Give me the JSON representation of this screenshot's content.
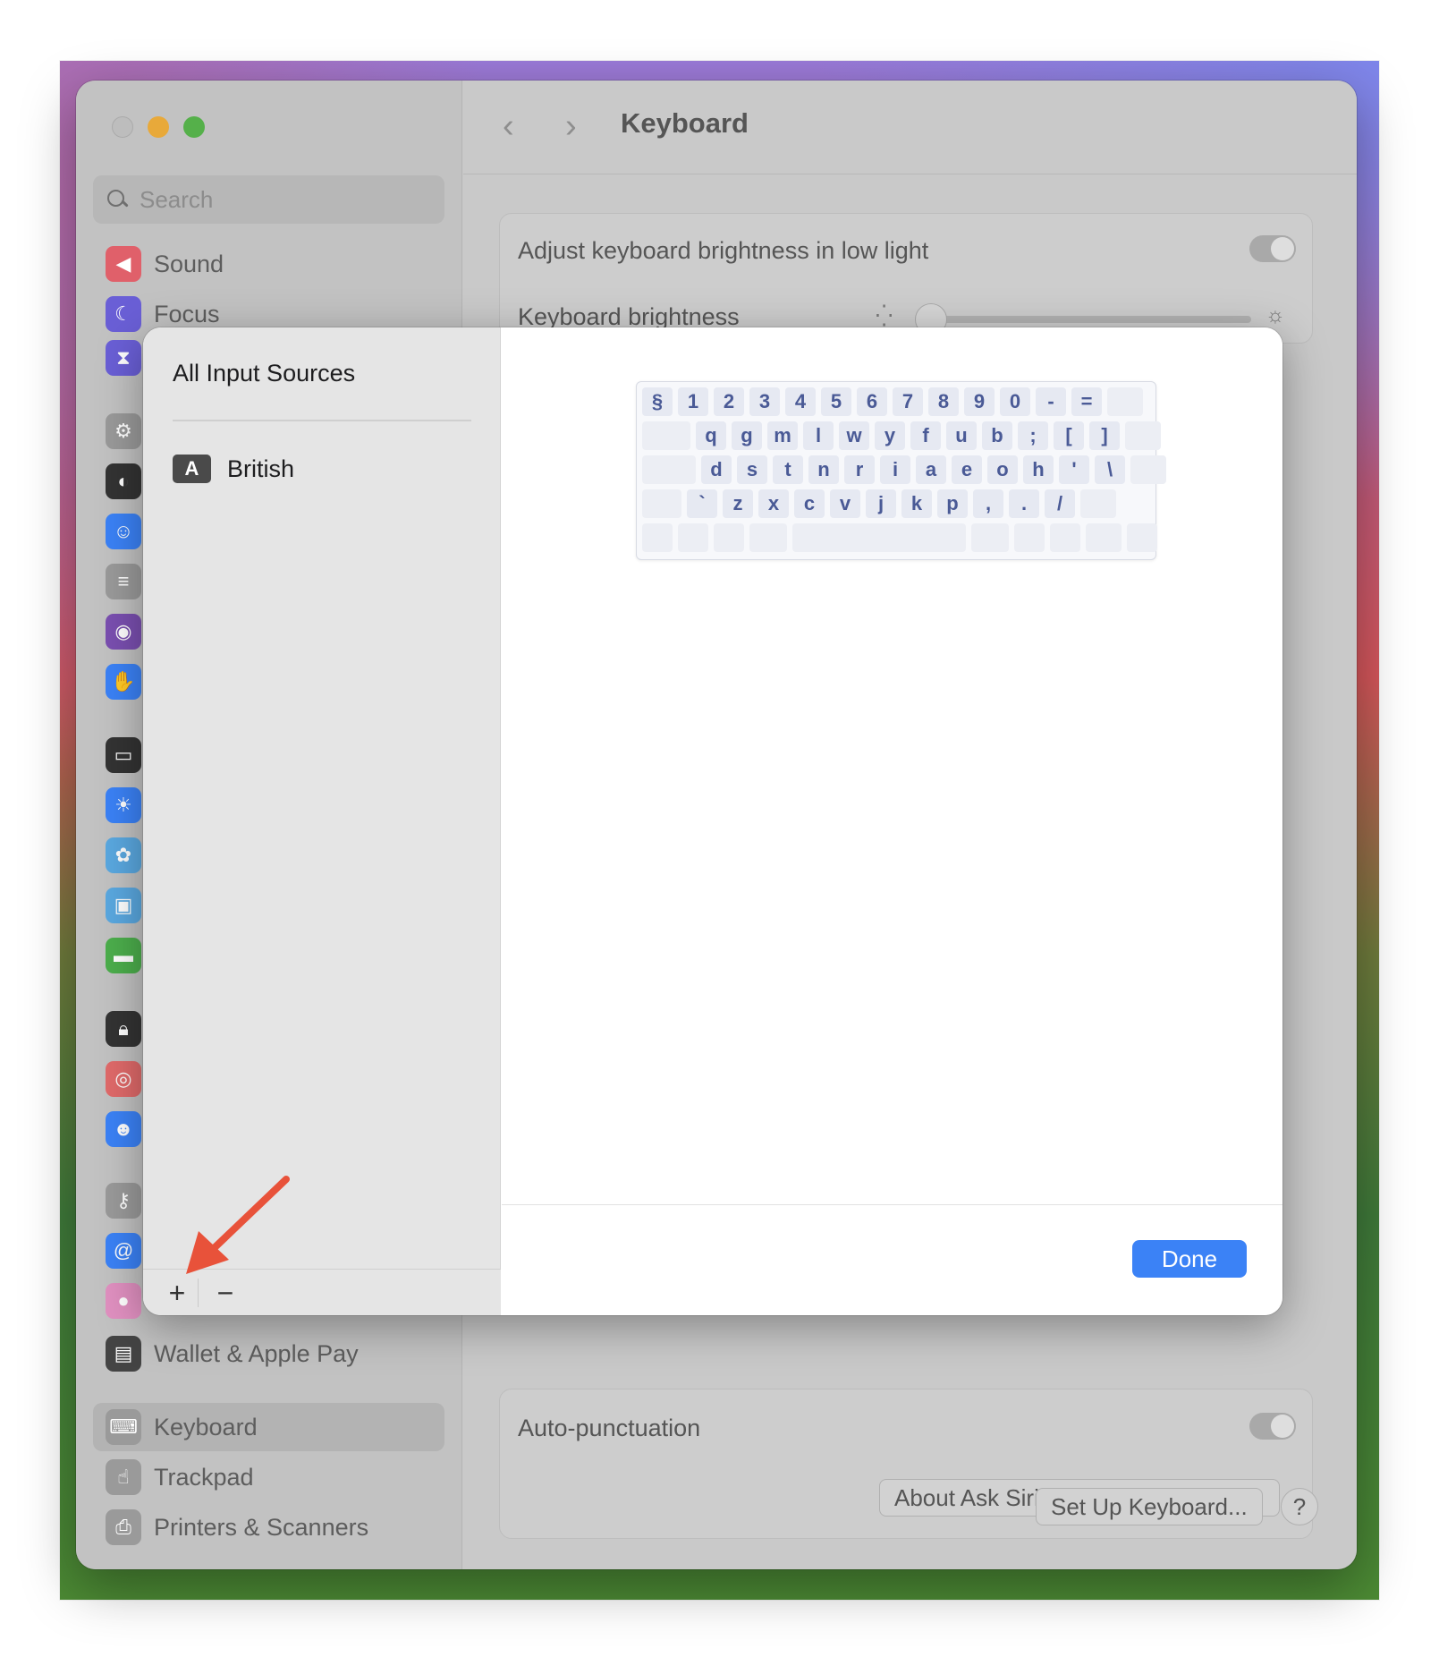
{
  "window": {
    "title": "Keyboard",
    "nav_back": "‹",
    "nav_forward": "›"
  },
  "sidebar": {
    "search_placeholder": "Search",
    "items_top": [
      {
        "label": "Sound",
        "icon": "sound-icon",
        "color": "#e0606a"
      },
      {
        "label": "Focus",
        "icon": "focus-moon-icon",
        "color": "#6a5fd6"
      }
    ],
    "items_bottom": [
      {
        "label": "Wallet & Apple Pay",
        "icon": "wallet-icon",
        "color": "#444444"
      },
      {
        "label": "Keyboard",
        "icon": "keyboard-icon",
        "color": "#9a9a9a",
        "selected": true
      },
      {
        "label": "Trackpad",
        "icon": "trackpad-icon",
        "color": "#9a9a9a"
      },
      {
        "label": "Printers & Scanners",
        "icon": "printer-icon",
        "color": "#9a9a9a"
      }
    ],
    "icon_only": [
      {
        "icon": "screen-time-icon",
        "color": "#6a5fd6"
      },
      {
        "icon": "general-gear-icon",
        "color": "#9a9a9a"
      },
      {
        "icon": "appearance-icon",
        "color": "#333333"
      },
      {
        "icon": "accessibility-icon",
        "color": "#3b82f6"
      },
      {
        "icon": "control-center-icon",
        "color": "#9a9a9a"
      },
      {
        "icon": "siri-icon",
        "color": "#7a4fb0"
      },
      {
        "icon": "privacy-hand-icon",
        "color": "#3b82f6"
      },
      {
        "icon": "desktop-dock-icon",
        "color": "#333333"
      },
      {
        "icon": "displays-icon",
        "color": "#3b82f6"
      },
      {
        "icon": "screen-saver-icon",
        "color": "#5aa8e0"
      },
      {
        "icon": "wallpaper-icon",
        "color": "#5aa8e0"
      },
      {
        "icon": "battery-icon",
        "color": "#4cae4c"
      },
      {
        "icon": "lock-screen-icon",
        "color": "#333333"
      },
      {
        "icon": "touch-id-icon",
        "color": "#e06a6a"
      },
      {
        "icon": "users-groups-icon",
        "color": "#3b82f6"
      },
      {
        "icon": "passwords-key-icon",
        "color": "#9a9a9a"
      },
      {
        "icon": "internet-accounts-icon",
        "color": "#3b82f6"
      },
      {
        "icon": "game-center-icon",
        "color": "#e090c0"
      }
    ]
  },
  "main": {
    "rows": {
      "adjust_brightness": "Adjust keyboard brightness in low light",
      "keyboard_brightness": "Keyboard brightness",
      "auto_punctuation": "Auto-punctuation"
    },
    "about_siri_button": "About Ask Siri, Dictation & Privacy...",
    "setup_keyboard_button": "Set Up Keyboard...",
    "help_button": "?"
  },
  "sheet": {
    "heading": "All Input Sources",
    "sources": [
      {
        "badge": "A",
        "label": "British"
      }
    ],
    "add_button": "+",
    "remove_button": "−",
    "done_button": "Done",
    "keyboard_rows": [
      [
        "§",
        "1",
        "2",
        "3",
        "4",
        "5",
        "6",
        "7",
        "8",
        "9",
        "0",
        "-",
        "="
      ],
      [
        "q",
        "g",
        "m",
        "l",
        "w",
        "y",
        "f",
        "u",
        "b",
        ";",
        "[",
        "]"
      ],
      [
        "d",
        "s",
        "t",
        "n",
        "r",
        "i",
        "a",
        "e",
        "o",
        "h",
        "'",
        "\\"
      ],
      [
        "`",
        "z",
        "x",
        "c",
        "v",
        "j",
        "k",
        "p",
        ",",
        ".",
        "/"
      ]
    ]
  },
  "colors": {
    "accent": "#3b82f6",
    "annotation_arrow": "#e8523a"
  }
}
